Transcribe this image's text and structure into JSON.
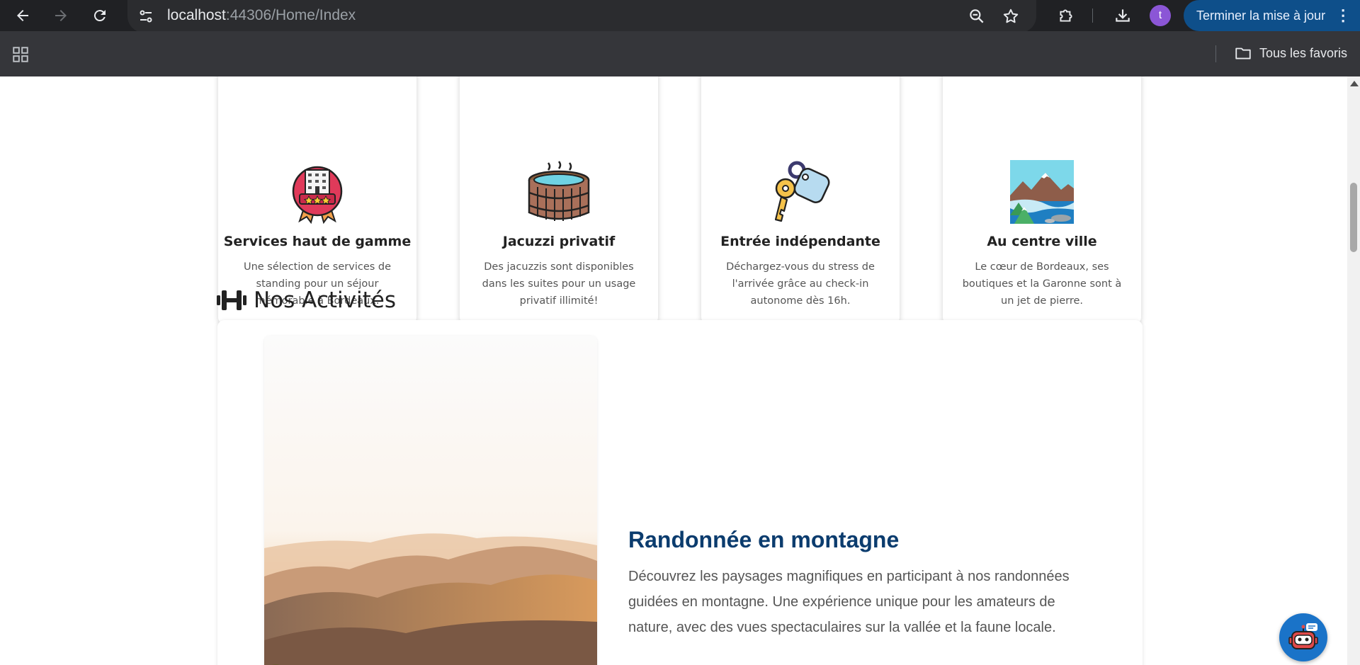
{
  "browser": {
    "url_host": "localhost",
    "url_rest": ":44306/Home/Index",
    "avatar_letter": "t",
    "update_label": "Terminer la mise à jour",
    "favorites_label": "Tous les favoris",
    "accent_color": "#0e4f8a"
  },
  "features": [
    {
      "title": "Services haut de gamme",
      "text": "Une sélection de services de standing pour un séjour mémorable à Bordeaux.",
      "icon": "award-building-icon"
    },
    {
      "title": "Jacuzzi privatif",
      "text": "Des jacuzzis sont disponibles dans les suites pour un usage privatif illimité!",
      "icon": "hot-tub-icon"
    },
    {
      "title": "Entrée indépendante",
      "text": "Déchargez-vous du stress de l'arrivée grâce au check-in autonome dès 16h.",
      "icon": "keys-icon"
    },
    {
      "title": "Au centre ville",
      "text": "Le cœur de Bordeaux, ses boutiques et la Garonne sont à un jet de pierre.",
      "icon": "landscape-icon"
    }
  ],
  "activities": {
    "heading": "Nos Activités",
    "item": {
      "title": "Randonnée en montagne",
      "description": "Découvrez les paysages magnifiques en participant à nos randonnées guidées en montagne. Une expérience unique pour les amateurs de nature, avec des vues spectaculaires sur la vallée et la faune locale."
    }
  }
}
